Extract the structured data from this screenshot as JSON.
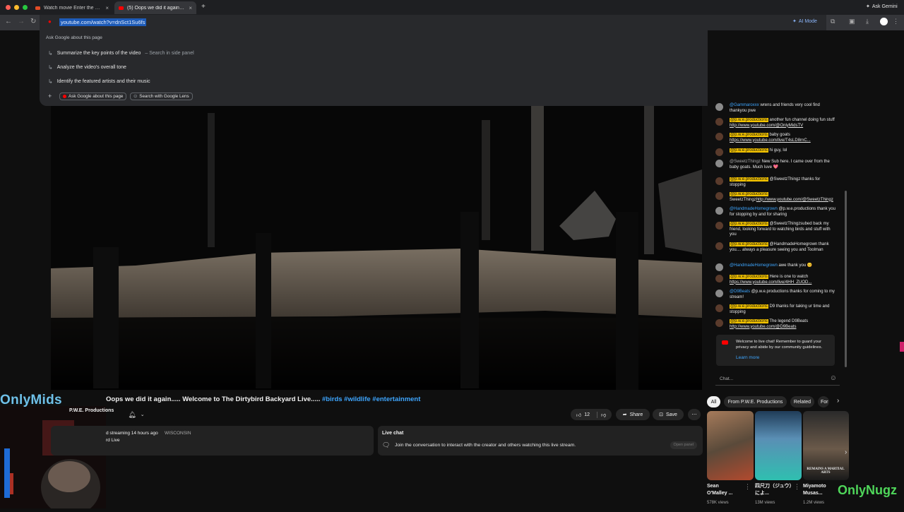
{
  "browser": {
    "tabs": [
      {
        "title": "Watch movie Enter the Ninja"
      },
      {
        "title": "(5) Oops we did it again..... W"
      }
    ],
    "new_tab_label": "+",
    "ask_gemini": "Ask Gemini",
    "url": "youtube.com/watch?v=dnSct1Su6fs",
    "ai_mode": "AI Mode"
  },
  "omnibox": {
    "header": "Ask Google about this page",
    "suggestions": [
      {
        "text": "Summarize the key points of the video",
        "hint": "–  Search in side panel"
      },
      {
        "text": "Analyze the video's overall tone",
        "hint": ""
      },
      {
        "text": "Identify the featured artists and their music",
        "hint": ""
      }
    ],
    "chips": [
      "Ask Google about this page",
      "Search with Google Lens"
    ]
  },
  "video": {
    "title_prefix": "Oops we did it again..... Welcome to The Dirtybird Backyard Live..... ",
    "hashtags": "#birds #wildlife #entertainment",
    "channel": "P.W.E. Productions",
    "like_count": "12",
    "share_label": "Share",
    "save_label": "Save",
    "streaming_info": "d streaming 14 hours ago",
    "location": "WISCONSIN",
    "desc_line2": "rd Live",
    "live_chat_title": "Live chat",
    "live_chat_text": "Join the conversation to interact with the creator and others watching this live stream.",
    "open_panel": "Open panel"
  },
  "overlay": {
    "left_logo": "OnlyMids",
    "right_logo": "OnlyNugz"
  },
  "chat": {
    "messages": [
      {
        "author": "@Gammaroxxx",
        "text": "wrens and friends very cool find thankyou pwe",
        "tag": false
      },
      {
        "author": "@p.w.e.productions",
        "text": "another fun channel doing fun stuff ",
        "link": "http://www.youtube.com/@OnlyMidsTV",
        "tag": true
      },
      {
        "author": "@p.w.e.productions",
        "text": "baby goats ",
        "link": "https://www.youtube.com/live/T4sLD8rnC...",
        "tag": true
      },
      {
        "author": "@p.w.e.productions",
        "text": "hi guy, lol",
        "tag": true
      },
      {
        "author": "@SweetzThingz",
        "text": "New Sub here. I came over from the baby goats. Much luve 💖",
        "tag": false
      },
      {
        "author": "@p.w.e.productions",
        "text": "@SweetzThingz thanks for stopping",
        "tag": true
      },
      {
        "author": "@p.w.e.productions",
        "text": "SweetzThingz",
        "link": "http://www.youtube.com/@SweetzThingz",
        "tag": true
      },
      {
        "author": "@HandmadeHomegrown",
        "text": "@p.w.e.productions thank you for stopping by and for sharing",
        "tag": false
      },
      {
        "author": "@p.w.e.productions",
        "text": "@SweetzThingzsubed back my friend, looking forward to watching birds and stuff with you",
        "tag": true
      },
      {
        "author": "@p.w.e.productions",
        "text": "@HandmadeHomegrown thank you.... always a pleasure seeing you and Toolman",
        "tag": true
      },
      {
        "author": "@HandmadeHomegrown",
        "text": "awe thank you 😊",
        "tag": false
      },
      {
        "author": "@p.w.e.productions",
        "text": "Here is one to watch ",
        "link": "https://www.youtube.com/live/4HH_ZUOD...",
        "tag": true
      },
      {
        "author": "@D9Beats",
        "text": "@p.w.e.productions thanks for coming to my stream!",
        "tag": false
      },
      {
        "author": "@p.w.e.productions",
        "text": "D9 thanks for taking ur time and stopping",
        "tag": true
      },
      {
        "author": "@p.w.e.productions",
        "text": "The legend D9Beats ",
        "link": "http://www.youtube.com/@D9Beats",
        "tag": true
      }
    ],
    "welcome": "Welcome to live chat! Remember to guard your privacy and abide by our community guidelines.",
    "learn_more": "Learn more",
    "input_placeholder": "Chat..."
  },
  "related": {
    "filters": [
      "All",
      "From P.W.E. Productions",
      "Related",
      "For"
    ],
    "videos": [
      {
        "title": "Sean O'Malley ...",
        "views": "578K views"
      },
      {
        "title": "四尺刀（ジュウ）によ...",
        "views": "13M views"
      },
      {
        "title": "Miyamoto Musas...",
        "views": "1.2M views",
        "thumb_text": "REMAINS A MARTIAL ARTS"
      }
    ]
  }
}
